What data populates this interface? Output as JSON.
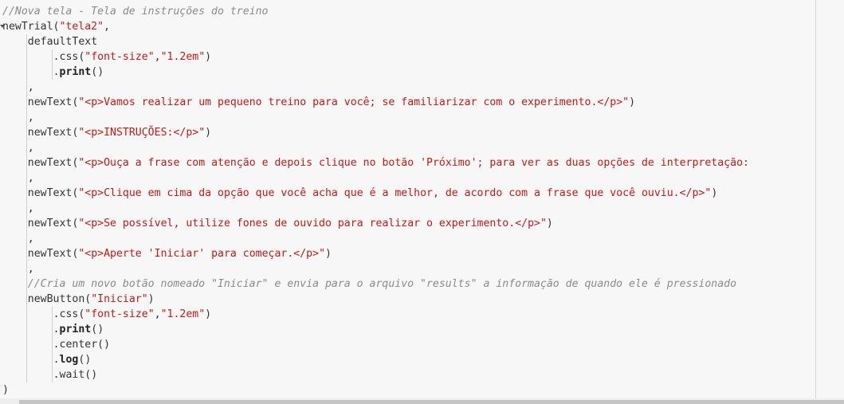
{
  "editor": {
    "lines": [
      {
        "indent": 1,
        "fold": false,
        "segs": [
          {
            "c": "cm",
            "t": "//Nova tela - Tela de instruções do treino"
          }
        ]
      },
      {
        "indent": 1,
        "fold": true,
        "segs": [
          {
            "c": "pl",
            "t": "newTrial("
          },
          {
            "c": "st",
            "t": "\"tela2\""
          },
          {
            "c": "pl",
            "t": ","
          }
        ]
      },
      {
        "indent": 5,
        "fold": false,
        "segs": [
          {
            "c": "pl",
            "t": "defaultText"
          }
        ]
      },
      {
        "indent": 9,
        "fold": false,
        "segs": [
          {
            "c": "pl",
            "t": ".css("
          },
          {
            "c": "st",
            "t": "\"font-size\""
          },
          {
            "c": "pl",
            "t": ","
          },
          {
            "c": "st",
            "t": "\"1.2em\""
          },
          {
            "c": "pl",
            "t": ")"
          }
        ]
      },
      {
        "indent": 9,
        "fold": false,
        "segs": [
          {
            "c": "pl",
            "t": "."
          },
          {
            "c": "kw",
            "t": "print"
          },
          {
            "c": "pl",
            "t": "()"
          }
        ]
      },
      {
        "indent": 5,
        "fold": false,
        "segs": [
          {
            "c": "pl",
            "t": ","
          }
        ]
      },
      {
        "indent": 5,
        "fold": false,
        "segs": [
          {
            "c": "pl",
            "t": "newText("
          },
          {
            "c": "st",
            "t": "\""
          },
          {
            "c": "tg",
            "t": "<p>"
          },
          {
            "c": "st",
            "t": "Vamos realizar um pequeno treino para você; se familiarizar com o experimento."
          },
          {
            "c": "tg",
            "t": "</p>"
          },
          {
            "c": "st",
            "t": "\""
          },
          {
            "c": "pl",
            "t": ")"
          }
        ]
      },
      {
        "indent": 5,
        "fold": false,
        "segs": [
          {
            "c": "pl",
            "t": ","
          }
        ]
      },
      {
        "indent": 5,
        "fold": false,
        "segs": [
          {
            "c": "pl",
            "t": "newText("
          },
          {
            "c": "st",
            "t": "\""
          },
          {
            "c": "tg",
            "t": "<p>"
          },
          {
            "c": "st",
            "t": "INSTRUÇÕES:"
          },
          {
            "c": "tg",
            "t": "</p>"
          },
          {
            "c": "st",
            "t": "\""
          },
          {
            "c": "pl",
            "t": ")"
          }
        ]
      },
      {
        "indent": 5,
        "fold": false,
        "segs": [
          {
            "c": "pl",
            "t": ","
          }
        ]
      },
      {
        "indent": 5,
        "fold": false,
        "segs": [
          {
            "c": "pl",
            "t": "newText("
          },
          {
            "c": "st",
            "t": "\""
          },
          {
            "c": "tg",
            "t": "<p>"
          },
          {
            "c": "st",
            "t": "Ouça a frase com atenção e depois clique no botão 'Próximo'; para ver as duas opções de interpretação:"
          }
        ]
      },
      {
        "indent": 5,
        "fold": false,
        "segs": [
          {
            "c": "pl",
            "t": ","
          }
        ]
      },
      {
        "indent": 5,
        "fold": false,
        "segs": [
          {
            "c": "pl",
            "t": "newText("
          },
          {
            "c": "st",
            "t": "\""
          },
          {
            "c": "tg",
            "t": "<p>"
          },
          {
            "c": "st",
            "t": "Clique em cima da opção que você acha que é a melhor, de acordo com a frase que você ouviu."
          },
          {
            "c": "tg",
            "t": "</p>"
          },
          {
            "c": "st",
            "t": "\""
          },
          {
            "c": "pl",
            "t": ")"
          }
        ]
      },
      {
        "indent": 5,
        "fold": false,
        "segs": [
          {
            "c": "pl",
            "t": ","
          }
        ]
      },
      {
        "indent": 5,
        "fold": false,
        "segs": [
          {
            "c": "pl",
            "t": "newText("
          },
          {
            "c": "st",
            "t": "\""
          },
          {
            "c": "tg",
            "t": "<p>"
          },
          {
            "c": "st",
            "t": "Se possível, utilize fones de ouvido para realizar o experimento."
          },
          {
            "c": "tg",
            "t": "</p>"
          },
          {
            "c": "st",
            "t": "\""
          },
          {
            "c": "pl",
            "t": ")"
          }
        ]
      },
      {
        "indent": 5,
        "fold": false,
        "segs": [
          {
            "c": "pl",
            "t": ","
          }
        ]
      },
      {
        "indent": 5,
        "fold": false,
        "segs": [
          {
            "c": "pl",
            "t": "newText("
          },
          {
            "c": "st",
            "t": "\""
          },
          {
            "c": "tg",
            "t": "<p>"
          },
          {
            "c": "st",
            "t": "Aperte 'Iniciar' para começar."
          },
          {
            "c": "tg",
            "t": "</p>"
          },
          {
            "c": "st",
            "t": "\""
          },
          {
            "c": "pl",
            "t": ")"
          }
        ]
      },
      {
        "indent": 5,
        "fold": false,
        "segs": [
          {
            "c": "pl",
            "t": ","
          }
        ]
      },
      {
        "indent": 5,
        "fold": false,
        "segs": [
          {
            "c": "cm",
            "t": "//Cria um novo botão nomeado \"Iniciar\" e envia para o arquivo \"results\" a informação de quando ele é pressionado"
          }
        ]
      },
      {
        "indent": 5,
        "fold": false,
        "segs": [
          {
            "c": "pl",
            "t": "newButton("
          },
          {
            "c": "st",
            "t": "\"Iniciar\""
          },
          {
            "c": "pl",
            "t": ")"
          }
        ]
      },
      {
        "indent": 9,
        "fold": false,
        "segs": [
          {
            "c": "pl",
            "t": ".css("
          },
          {
            "c": "st",
            "t": "\"font-size\""
          },
          {
            "c": "pl",
            "t": ","
          },
          {
            "c": "st",
            "t": "\"1.2em\""
          },
          {
            "c": "pl",
            "t": ")"
          }
        ]
      },
      {
        "indent": 9,
        "fold": false,
        "segs": [
          {
            "c": "pl",
            "t": "."
          },
          {
            "c": "kw",
            "t": "print"
          },
          {
            "c": "pl",
            "t": "()"
          }
        ]
      },
      {
        "indent": 9,
        "fold": false,
        "segs": [
          {
            "c": "pl",
            "t": ".center()"
          }
        ]
      },
      {
        "indent": 9,
        "fold": false,
        "segs": [
          {
            "c": "pl",
            "t": "."
          },
          {
            "c": "kw",
            "t": "log"
          },
          {
            "c": "pl",
            "t": "()"
          }
        ]
      },
      {
        "indent": 9,
        "fold": false,
        "segs": [
          {
            "c": "pl",
            "t": ".wait()"
          }
        ]
      },
      {
        "indent": 1,
        "fold": false,
        "segs": [
          {
            "c": "pl",
            "t": ")"
          }
        ]
      }
    ],
    "guides": [
      {
        "col": 5,
        "from": 2,
        "to": 24
      },
      {
        "col": 9,
        "from": 3,
        "to": 4
      },
      {
        "col": 9,
        "from": 20,
        "to": 24
      }
    ]
  },
  "colors": {
    "background": "#f7f7f7",
    "comment": "#8a8a8a",
    "string": "#c41a16",
    "text": "#333333"
  }
}
